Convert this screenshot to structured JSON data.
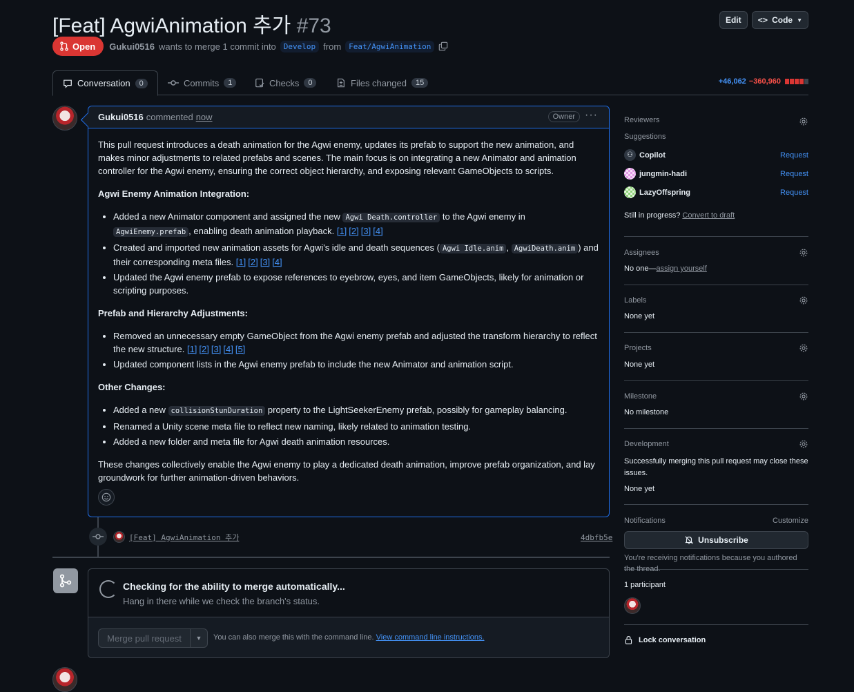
{
  "header": {
    "title": "[Feat] AgwiAnimation 추가",
    "number": "#73",
    "edit_label": "Edit",
    "code_label": "Code"
  },
  "meta": {
    "state": "Open",
    "author": "Gukui0516",
    "text_merge": "wants to merge 1 commit into",
    "base_branch": "Develop",
    "text_from": "from",
    "head_branch": "Feat/AgwiAnimation"
  },
  "tabs": [
    {
      "label": "Conversation",
      "count": "0"
    },
    {
      "label": "Commits",
      "count": "1"
    },
    {
      "label": "Checks",
      "count": "0"
    },
    {
      "label": "Files changed",
      "count": "15"
    }
  ],
  "diffstat": {
    "additions": "+46,062",
    "deletions": "−360,960"
  },
  "comment": {
    "author": "Gukui0516",
    "action": "commented",
    "time": "now",
    "badge": "Owner",
    "intro": "This pull request introduces a death animation for the Agwi enemy, updates its prefab to support the new animation, and makes minor adjustments to related prefabs and scenes. The main focus is on integrating a new Animator and animation controller for the Agwi enemy, ensuring the correct object hierarchy, and exposing relevant GameObjects to scripts.",
    "h1": "Agwi Enemy Animation Integration:",
    "s1": {
      "b1_pre": "Added a new Animator component and assigned the new",
      "b1_code1": "Agwi Death.controller",
      "b1_mid": "to the Agwi enemy in",
      "b1_code2": "AgwiEnemy.prefab",
      "b1_post": ", enabling death animation playback.",
      "b2_pre": "Created and imported new animation assets for Agwi's idle and death sequences (",
      "b2_code1": "Agwi Idle.anim",
      "b2_sep": ",",
      "b2_code2": "AgwiDeath.anim",
      "b2_post": ") and their corresponding meta files.",
      "b3": "Updated the Agwi enemy prefab to expose references to eyebrow, eyes, and item GameObjects, likely for animation or scripting purposes."
    },
    "h2": "Prefab and Hierarchy Adjustments:",
    "s2": {
      "b1": "Removed an unnecessary empty GameObject from the Agwi enemy prefab and adjusted the transform hierarchy to reflect the new structure.",
      "b2": "Updated component lists in the Agwi enemy prefab to include the new Animator and animation script."
    },
    "h3": "Other Changes:",
    "s3": {
      "b1_pre": "Added a new",
      "b1_code": "collisionStunDuration",
      "b1_post": "property to the LightSeekerEnemy prefab, possibly for gameplay balancing.",
      "b2": "Renamed a Unity scene meta file to reflect new naming, likely related to animation testing.",
      "b3": "Added a new folder and meta file for Agwi death animation resources."
    },
    "outro": "These changes collectively enable the Agwi enemy to play a dedicated death animation, improve prefab organization, and lay groundwork for further animation-driven behaviors.",
    "refs": [
      "[1]",
      "[2]",
      "[3]",
      "[4]",
      "[5]"
    ]
  },
  "timeline": {
    "commit_message": "[Feat] AgwiAnimation 추가",
    "commit_sha": "4dbfb5e"
  },
  "merge": {
    "title": "Checking for the ability to merge automatically...",
    "subtitle": "Hang in there while we check the branch's status.",
    "button": "Merge pull request",
    "hint": "You can also merge this with the command line.",
    "hint_link": "View command line instructions."
  },
  "sidebar": {
    "reviewers_title": "Reviewers",
    "suggestions": "Suggestions",
    "reviewers": [
      {
        "name": "Copilot",
        "action": "Request"
      },
      {
        "name": "jungmin-hadi",
        "action": "Request"
      },
      {
        "name": "LazyOffspring",
        "action": "Request"
      }
    ],
    "in_progress": "Still in progress?",
    "convert_draft": "Convert to draft",
    "assignees_title": "Assignees",
    "assignees_none": "No one—",
    "assign_yourself": "assign yourself",
    "labels_title": "Labels",
    "labels_value": "None yet",
    "projects_title": "Projects",
    "projects_value": "None yet",
    "milestone_title": "Milestone",
    "milestone_value": "No milestone",
    "development_title": "Development",
    "development_text": "Successfully merging this pull request may close these issues.",
    "development_value": "None yet",
    "notifications_title": "Notifications",
    "customize": "Customize",
    "unsubscribe": "Unsubscribe",
    "notify_reason": "You're receiving notifications because you authored the thread.",
    "participants": "1 participant",
    "lock": "Lock conversation"
  },
  "colors": {
    "accent": "#4493f8",
    "open_badge": "#da3633",
    "border": "#3d444d",
    "bg": "#0d1117"
  }
}
